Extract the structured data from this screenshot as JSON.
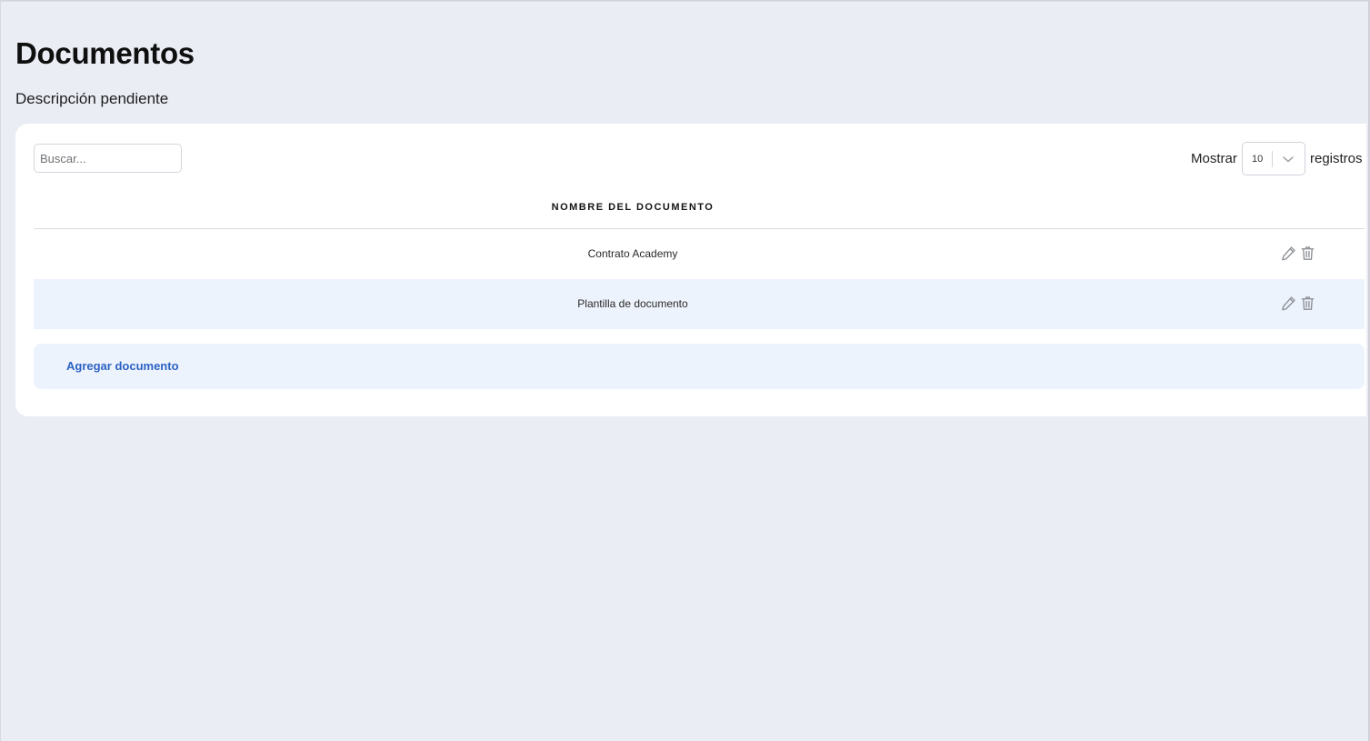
{
  "page": {
    "title": "Documentos",
    "subtitle": "Descripción pendiente"
  },
  "toolbar": {
    "search_placeholder": "Buscar...",
    "show_label": "Mostrar",
    "page_size": "10",
    "records_label": "registros"
  },
  "table": {
    "columns": [
      "NOMBRE DEL DOCUMENTO"
    ],
    "rows": [
      {
        "name": "Contrato Academy",
        "actions": [
          "pencil-icon",
          "trash-icon"
        ]
      },
      {
        "name": "Plantilla de documento",
        "actions": [
          "pencil-icon",
          "trash-icon"
        ]
      }
    ]
  },
  "add_bar": {
    "label": "Agregar documento"
  },
  "colors": {
    "page_background": "#eaedf4",
    "card_background": "#ffffff",
    "row_highlight": "#edf3fc",
    "link_blue": "#2c62c4",
    "icon_gray": "#8a8d93"
  }
}
